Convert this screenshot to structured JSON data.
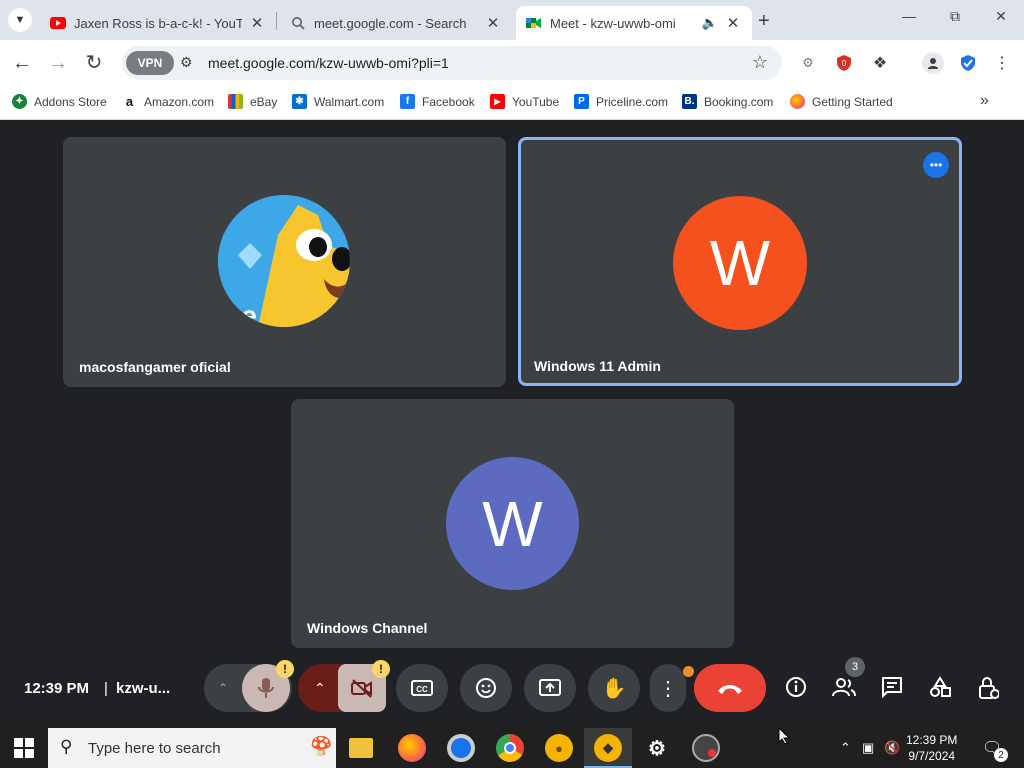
{
  "browser": {
    "tabs": [
      {
        "title": "Jaxen Ross is b-a-c-k! - YouTube",
        "favicon": "youtube-icon",
        "active": false
      },
      {
        "title": "meet.google.com - Search",
        "favicon": "search-icon",
        "active": false
      },
      {
        "title": "Meet - kzw-uwwb-omi",
        "favicon": "meet-icon",
        "active": true,
        "audio": true
      }
    ],
    "vpn_label": "VPN",
    "url": "meet.google.com/kzw-uwwb-omi?pli=1",
    "bookmarks": [
      {
        "label": "Addons Store",
        "icon": "addons-icon",
        "color": "#188038"
      },
      {
        "label": "Amazon.com",
        "icon": "amazon-icon",
        "color": "#111111"
      },
      {
        "label": "eBay",
        "icon": "ebay-icon",
        "color": "#e53238"
      },
      {
        "label": "Walmart.com",
        "icon": "walmart-icon",
        "color": "#0071ce"
      },
      {
        "label": "Facebook",
        "icon": "facebook-icon",
        "color": "#1877f2"
      },
      {
        "label": "YouTube",
        "icon": "youtube-icon",
        "color": "#ff0000"
      },
      {
        "label": "Priceline.com",
        "icon": "priceline-icon",
        "color": "#0068ef"
      },
      {
        "label": "Booking.com",
        "icon": "booking-icon",
        "color": "#003580"
      },
      {
        "label": "Getting Started",
        "icon": "firefox-icon",
        "color": "#ff7139"
      }
    ]
  },
  "meet": {
    "participants": [
      {
        "name": "macosfangamer oficial",
        "avatar_type": "image",
        "speaking": false
      },
      {
        "name": "Windows 11 Admin",
        "avatar_letter": "W",
        "avatar_color": "#f4511e",
        "speaking": true
      },
      {
        "name": "Windows Channel",
        "avatar_letter": "W",
        "avatar_color": "#5c6bc0",
        "speaking": false
      }
    ],
    "time": "12:39 PM",
    "meeting_code": "kzw-u...",
    "participant_count": "3",
    "colors": {
      "background": "#202124",
      "tile": "#3c4043",
      "end_call": "#ea4335",
      "speaking_border": "#8ab4f8"
    }
  },
  "taskbar": {
    "search_placeholder": "Type here to search",
    "time": "12:39 PM",
    "date": "9/7/2024",
    "notification_count": "2"
  }
}
